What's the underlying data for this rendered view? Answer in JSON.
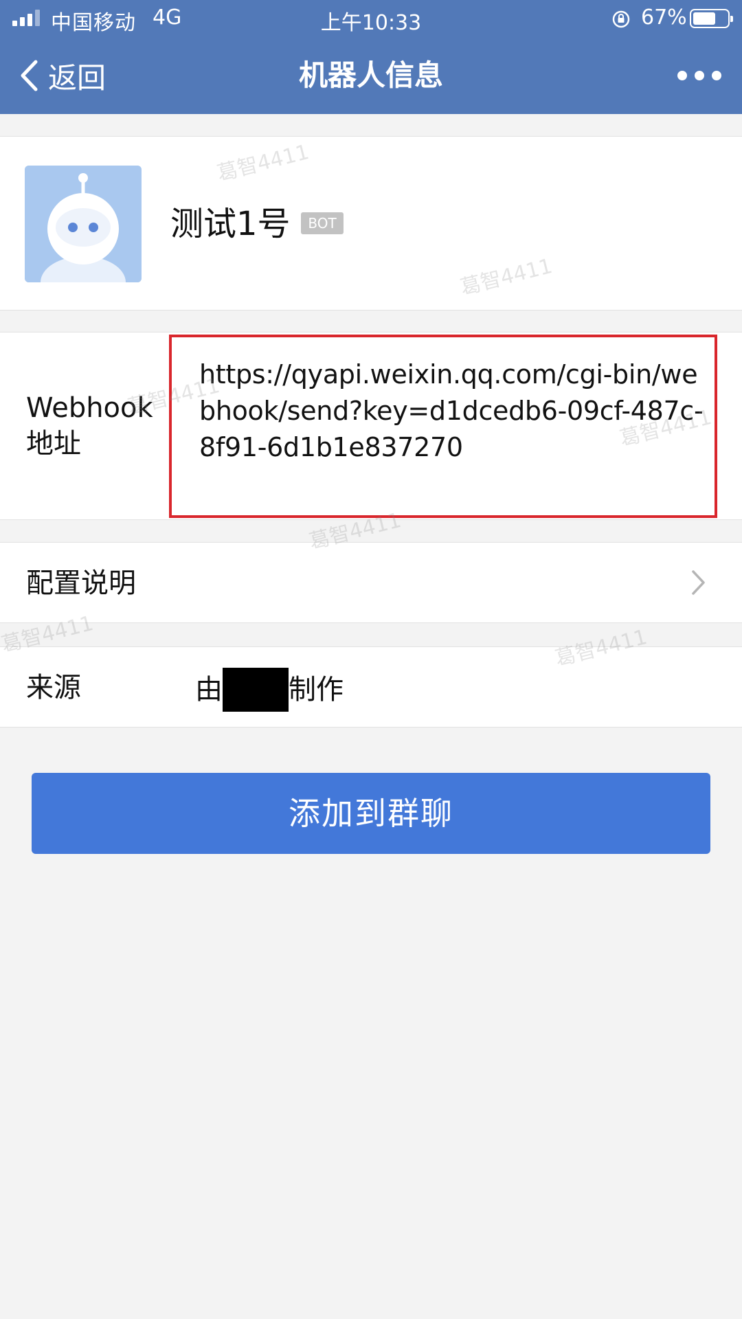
{
  "status_bar": {
    "carrier": "中国移动",
    "network": "4G",
    "time": "上午10:33",
    "battery": "67%",
    "battery_level": 0.67
  },
  "nav": {
    "back_label": "返回",
    "title": "机器人信息"
  },
  "profile": {
    "name": "测试1号",
    "badge": "BOT"
  },
  "webhook": {
    "label": "Webhook 地址",
    "url": "https://qyapi.weixin.qq.com/cgi-bin/webhook/send?key=d1dcedb6-09cf-487c-8f91-6d1b1e837270"
  },
  "config": {
    "label": "配置说明"
  },
  "source": {
    "label": "来源",
    "prefix": "由",
    "suffix": "制作"
  },
  "add_button": {
    "label": "添加到群聊"
  },
  "watermark": "葛智4411",
  "colors": {
    "header": "#5279b8",
    "primary_button": "#4378d9",
    "highlight_border": "#d9262c",
    "page_background": "#f3f3f3"
  }
}
